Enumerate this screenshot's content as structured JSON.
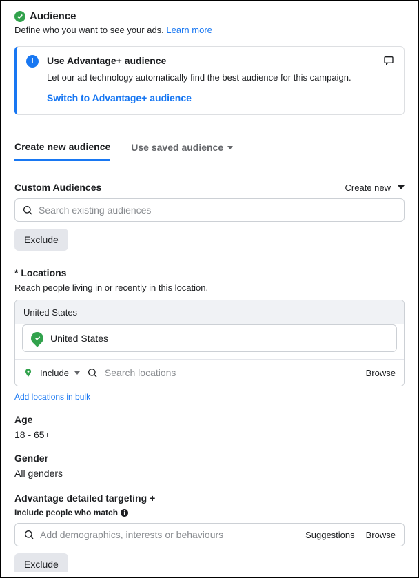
{
  "header": {
    "title": "Audience",
    "subtitle_prefix": "Define who you want to see your ads. ",
    "learn_more": "Learn more"
  },
  "info_card": {
    "title": "Use Advantage+ audience",
    "description": "Let our ad technology automatically find the best audience for this campaign.",
    "switch_link": "Switch to Advantage+ audience"
  },
  "tabs": {
    "create": "Create new audience",
    "saved": "Use saved audience"
  },
  "custom_audiences": {
    "label": "Custom Audiences",
    "create_new": "Create new",
    "search_placeholder": "Search existing audiences",
    "exclude": "Exclude"
  },
  "locations": {
    "label": "* Locations",
    "sub": "Reach people living in or recently in this location.",
    "group": "United States",
    "item": "United States",
    "include": "Include",
    "search_placeholder": "Search locations",
    "browse": "Browse",
    "bulk": "Add locations in bulk"
  },
  "age": {
    "label": "Age",
    "value": "18 - 65+"
  },
  "gender": {
    "label": "Gender",
    "value": "All genders"
  },
  "detailed": {
    "label": "Advantage detailed targeting",
    "sub": "Include people who match",
    "placeholder": "Add demographics, interests or behaviours",
    "suggestions": "Suggestions",
    "browse": "Browse",
    "exclude": "Exclude"
  }
}
